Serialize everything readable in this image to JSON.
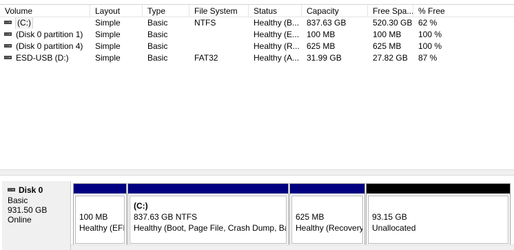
{
  "columns": [
    {
      "label": "Volume"
    },
    {
      "label": "Layout"
    },
    {
      "label": "Type"
    },
    {
      "label": "File System"
    },
    {
      "label": "Status"
    },
    {
      "label": "Capacity"
    },
    {
      "label": "Free Spa..."
    },
    {
      "label": "% Free"
    }
  ],
  "volumes": [
    {
      "volume": "(C:)",
      "layout": "Simple",
      "type": "Basic",
      "fs": "NTFS",
      "status": "Healthy (B...",
      "capacity": "837.63 GB",
      "free": "520.30 GB",
      "pct": "62 %",
      "icon": "drive-icon"
    },
    {
      "volume": "(Disk 0 partition 1)",
      "layout": "Simple",
      "type": "Basic",
      "fs": "",
      "status": "Healthy (E...",
      "capacity": "100 MB",
      "free": "100 MB",
      "pct": "100 %",
      "icon": "drive-icon"
    },
    {
      "volume": "(Disk 0 partition 4)",
      "layout": "Simple",
      "type": "Basic",
      "fs": "",
      "status": "Healthy (R...",
      "capacity": "625 MB",
      "free": "625 MB",
      "pct": "100 %",
      "icon": "drive-icon"
    },
    {
      "volume": "ESD-USB (D:)",
      "layout": "Simple",
      "type": "Basic",
      "fs": "FAT32",
      "status": "Healthy (A...",
      "capacity": "31.99 GB",
      "free": "27.82 GB",
      "pct": "87 %",
      "icon": "drive-icon"
    }
  ],
  "disk": {
    "name": "Disk 0",
    "type": "Basic",
    "size": "931.50 GB",
    "state": "Online",
    "icon": "drive-icon",
    "partitions": [
      {
        "title": "",
        "size": "100 MB",
        "status": "Healthy (EFI",
        "bar": "blue"
      },
      {
        "title": "(C:)",
        "size": "837.63 GB NTFS",
        "status": "Healthy (Boot, Page File, Crash Dump, Bas",
        "bar": "blue"
      },
      {
        "title": "",
        "size": "625 MB",
        "status": "Healthy (Recovery",
        "bar": "blue"
      },
      {
        "title": "",
        "size": "93.15 GB",
        "status": "Unallocated",
        "bar": "black"
      }
    ]
  },
  "colors": {
    "primary_partition": "#000080",
    "unallocated": "#000000"
  }
}
